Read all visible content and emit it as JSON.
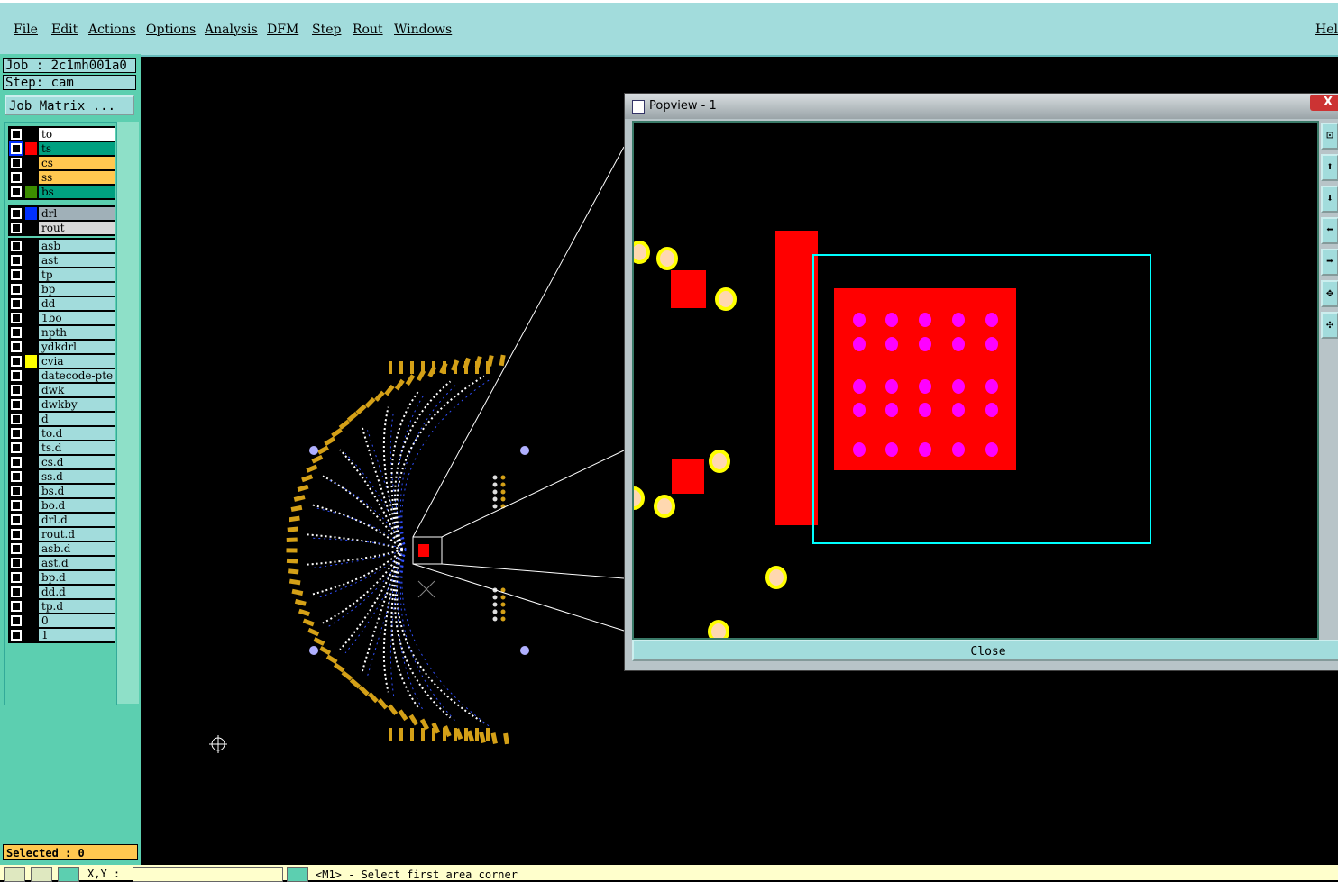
{
  "menu": [
    "File",
    "Edit",
    "Actions",
    "Options",
    "Analysis",
    "DFM",
    "Step",
    "Rout",
    "Windows",
    "Help"
  ],
  "job": "Job : 2c1mh001a0",
  "step": "Step: cam",
  "job_matrix": "Job Matrix ...",
  "layer_groups": [
    [
      {
        "name": "to",
        "bg": "#ffffff",
        "sw": ""
      },
      {
        "name": "ts",
        "bg": "#00a080",
        "sw": "#ff0000",
        "active": true
      },
      {
        "name": "cs",
        "bg": "#ffc850",
        "sw": ""
      },
      {
        "name": "ss",
        "bg": "#ffc850",
        "sw": ""
      },
      {
        "name": "bs",
        "bg": "#00a080",
        "sw": "#3c8c00"
      }
    ],
    [
      {
        "name": "drl",
        "bg": "#a0b0b8",
        "sw": "#0030ff"
      },
      {
        "name": "rout",
        "bg": "#d8d8d8",
        "sw": ""
      }
    ],
    [
      {
        "name": "asb"
      },
      {
        "name": "ast"
      },
      {
        "name": "tp"
      },
      {
        "name": "bp"
      },
      {
        "name": "dd"
      },
      {
        "name": "1bo"
      },
      {
        "name": "npth"
      },
      {
        "name": "ydkdrl"
      },
      {
        "name": "cvia",
        "sw": "#ffff00"
      },
      {
        "name": "datecode-pte"
      },
      {
        "name": "dwk"
      },
      {
        "name": "dwkby"
      },
      {
        "name": "d"
      },
      {
        "name": "to.d"
      },
      {
        "name": "ts.d"
      },
      {
        "name": "cs.d"
      },
      {
        "name": "ss.d"
      },
      {
        "name": "bs.d"
      },
      {
        "name": "bo.d"
      },
      {
        "name": "drl.d"
      },
      {
        "name": "rout.d"
      },
      {
        "name": "asb.d"
      },
      {
        "name": "ast.d"
      },
      {
        "name": "bp.d"
      },
      {
        "name": "dd.d"
      },
      {
        "name": "tp.d"
      },
      {
        "name": "0"
      },
      {
        "name": "1"
      }
    ]
  ],
  "selected": "Selected : 0",
  "status": {
    "xy_label": "X,Y :",
    "message": "<M1> - Select first area corner"
  },
  "popview": {
    "title": "Popview - 1",
    "close": "Close",
    "close_x": "X"
  },
  "colors": {
    "menu_bg": "#a2dcdc",
    "panel_bg": "#5ccfb0",
    "pad": "#ff0000",
    "via": "#ff00ff",
    "trace": "#d4a017",
    "select_box": "#00ffff"
  }
}
